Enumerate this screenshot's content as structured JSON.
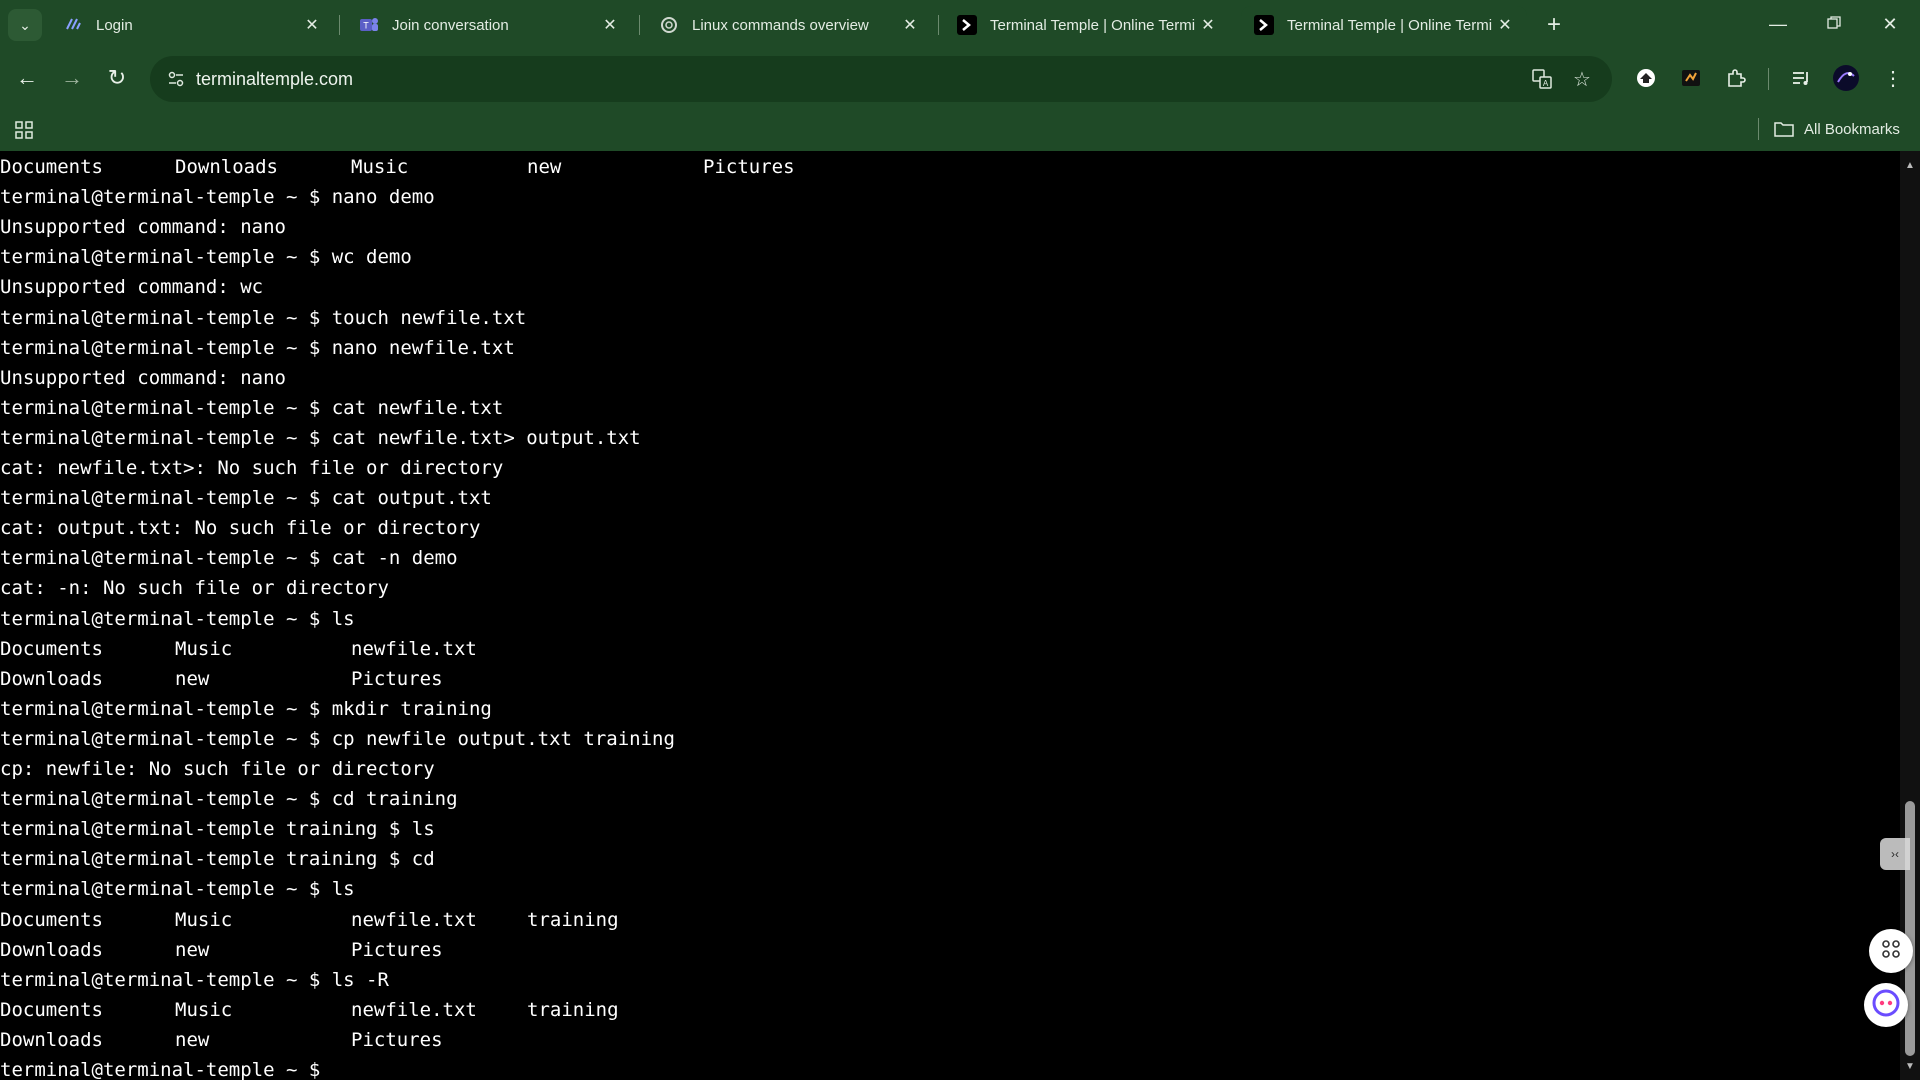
{
  "browser": {
    "tabs": [
      {
        "title": "Login",
        "icon": "swirl-favicon",
        "active": false
      },
      {
        "title": "Join conversation",
        "icon": "teams-favicon",
        "active": false
      },
      {
        "title": "Linux commands overview",
        "icon": "openai-favicon",
        "active": false
      },
      {
        "title": "Terminal Temple | Online Termin",
        "icon": "terminal-favicon",
        "active": false
      },
      {
        "title": "Terminal Temple | Online Termin",
        "icon": "terminal-favicon",
        "active": true
      }
    ],
    "url": "terminaltemple.com",
    "bookmarks": {
      "all_label": "All Bookmarks"
    },
    "theme_color": "#1f4a27"
  },
  "terminal": {
    "prompt_home": "terminal@terminal-temple ~ $",
    "lines": [
      {
        "cols": [
          "Documents",
          "Downloads",
          "Music",
          "new",
          "Pictures"
        ]
      },
      {
        "text": "terminal@terminal-temple ~ $ nano demo"
      },
      {
        "text": "Unsupported command: nano"
      },
      {
        "text": "terminal@terminal-temple ~ $ wc demo"
      },
      {
        "text": "Unsupported command: wc"
      },
      {
        "text": "terminal@terminal-temple ~ $ touch newfile.txt"
      },
      {
        "text": "terminal@terminal-temple ~ $ nano newfile.txt"
      },
      {
        "text": "Unsupported command: nano"
      },
      {
        "text": "terminal@terminal-temple ~ $ cat newfile.txt"
      },
      {
        "text": "terminal@terminal-temple ~ $ cat newfile.txt> output.txt"
      },
      {
        "text": "cat: newfile.txt>: No such file or directory"
      },
      {
        "text": "terminal@terminal-temple ~ $ cat output.txt"
      },
      {
        "text": "cat: output.txt: No such file or directory"
      },
      {
        "text": "terminal@terminal-temple ~ $ cat -n demo"
      },
      {
        "text": "cat: -n: No such file or directory"
      },
      {
        "text": "terminal@terminal-temple ~ $ ls"
      },
      {
        "cols": [
          "Documents",
          "Music",
          "newfile.txt"
        ]
      },
      {
        "cols": [
          "Downloads",
          "new",
          "Pictures"
        ]
      },
      {
        "text": "terminal@terminal-temple ~ $ mkdir training"
      },
      {
        "text": "terminal@terminal-temple ~ $ cp newfile output.txt training"
      },
      {
        "text": "cp: newfile: No such file or directory"
      },
      {
        "text": "terminal@terminal-temple ~ $ cd training"
      },
      {
        "text": "terminal@terminal-temple training $ ls"
      },
      {
        "text": "terminal@terminal-temple training $ cd"
      },
      {
        "text": "terminal@terminal-temple ~ $ ls"
      },
      {
        "cols": [
          "Documents",
          "Music",
          "newfile.txt",
          "training"
        ]
      },
      {
        "cols": [
          "Downloads",
          "new",
          "Pictures"
        ]
      },
      {
        "text": "terminal@terminal-temple ~ $ ls -R"
      },
      {
        "cols": [
          "Documents",
          "Music",
          "newfile.txt",
          "training"
        ]
      },
      {
        "cols": [
          "Downloads",
          "new",
          "Pictures"
        ]
      },
      {
        "text": "terminal@terminal-temple ~ $"
      }
    ]
  }
}
